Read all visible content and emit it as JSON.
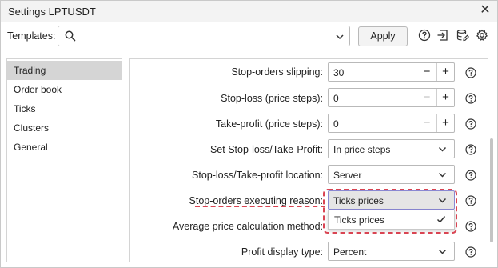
{
  "window": {
    "title": "Settings LPTUSDT"
  },
  "templates": {
    "label": "Templates:",
    "search_value": "",
    "apply_label": "Apply"
  },
  "sidebar": {
    "items": [
      {
        "label": "Trading",
        "active": true
      },
      {
        "label": "Order book"
      },
      {
        "label": "Ticks"
      },
      {
        "label": "Clusters"
      },
      {
        "label": "General"
      }
    ]
  },
  "settings": {
    "stop_orders_slipping": {
      "label": "Stop-orders slipping:",
      "value": "30"
    },
    "stop_loss": {
      "label": "Stop-loss (price steps):",
      "value": "0"
    },
    "take_profit": {
      "label": "Take-profit (price steps):",
      "value": "0"
    },
    "set_sl_tp": {
      "label": "Set Stop-loss/Take-Profit:",
      "value": "In price steps"
    },
    "sl_tp_location": {
      "label": "Stop-loss/Take-profit location:",
      "value": "Server"
    },
    "stop_orders_reason": {
      "label": "Stop-orders executing reason:",
      "value": "Ticks prices"
    },
    "avg_price_method": {
      "label": "Average price calculation method:"
    },
    "profit_display_type": {
      "label": "Profit display type:",
      "value": "Percent"
    }
  },
  "dropdown": {
    "options": [
      {
        "label": "Ticks prices",
        "selected": true
      }
    ]
  },
  "colors": {
    "annotation": "#d94452",
    "active_sidebar": "#d5d5d5",
    "focus_border": "#8a88d2"
  }
}
